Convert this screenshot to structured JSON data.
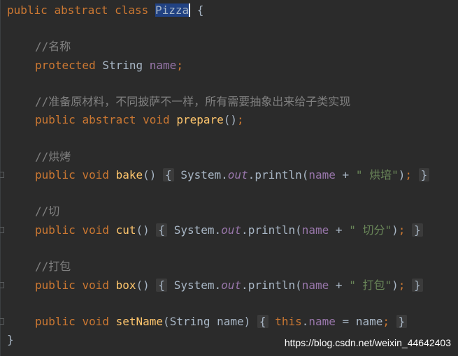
{
  "code": {
    "keywords": {
      "public": "public",
      "abstract": "abstract",
      "class": "class",
      "protected": "protected",
      "void": "void",
      "this": "this"
    },
    "class_name": "Pizza",
    "open_brace": " {",
    "close_brace": "}",
    "type_string": "String",
    "field_name": "name",
    "system": "System",
    "out": "out",
    "println": "println",
    "comments": {
      "name": "//名称",
      "prepare": "//准备原材料，不同披萨不一样，所有需要抽象出来给子类实现",
      "bake": "//烘烤",
      "cut": "//切",
      "box": "//打包"
    },
    "methods": {
      "prepare": "prepare",
      "bake": "bake",
      "cut": "cut",
      "box": "box",
      "set_name": "setName"
    },
    "strings": {
      "bake": "\" 烘培\"",
      "cut": "\" 切分\"",
      "box": "\" 打包\""
    }
  },
  "watermark": "https://blog.csdn.net/weixin_44642403",
  "colors": {
    "background": "#2b2b2b",
    "keyword": "#cc7832",
    "comment": "#808080",
    "field": "#9876aa",
    "method": "#ffc66d",
    "string": "#6a8759",
    "default": "#a9b7c6",
    "selection": "#214283"
  }
}
